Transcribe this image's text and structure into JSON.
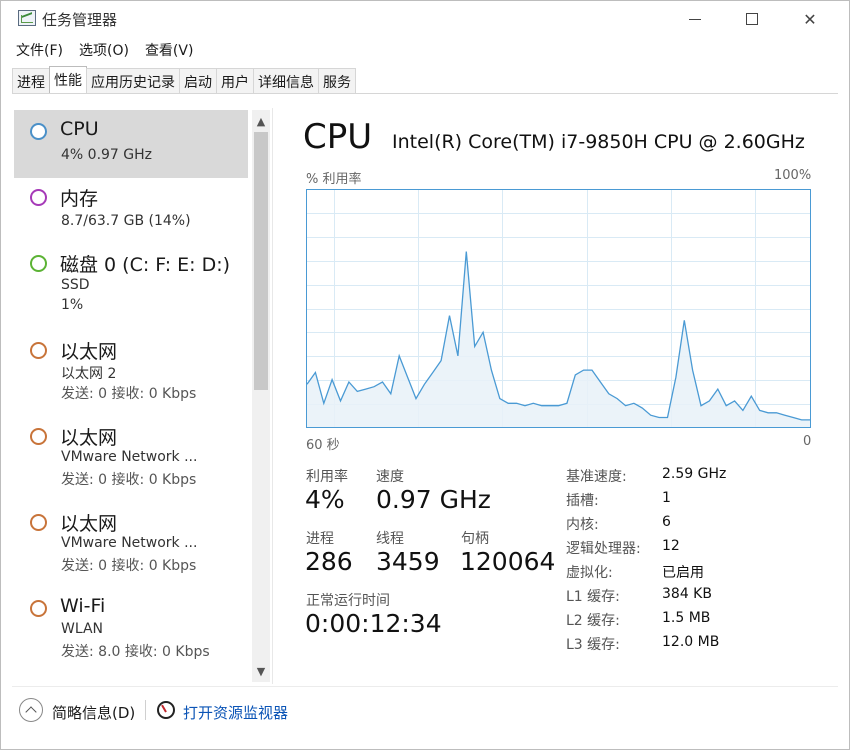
{
  "window": {
    "title": "任务管理器",
    "menu": [
      "文件(F)",
      "选项(O)",
      "查看(V)"
    ],
    "tabs": [
      "进程",
      "性能",
      "应用历史记录",
      "启动",
      "用户",
      "详细信息",
      "服务"
    ],
    "active_tab": "性能"
  },
  "resources": [
    {
      "name": "CPU",
      "sub": "4%  0.97 GHz",
      "sub2": "",
      "color": "#4a90c8",
      "selected": true
    },
    {
      "name": "内存",
      "sub": "8.7/63.7 GB (14%)",
      "sub2": "",
      "color": "#a63ab8",
      "selected": false
    },
    {
      "name": "磁盘 0 (C: F: E: D:)",
      "sub": "SSD",
      "sub2": "1%",
      "color": "#5cb335",
      "selected": false
    },
    {
      "name": "以太网",
      "sub": "以太网 2",
      "sub2": "发送: 0 接收: 0 Kbps",
      "color": "#c8743a",
      "selected": false
    },
    {
      "name": "以太网",
      "sub": "VMware Network ...",
      "sub2": "发送: 0 接收: 0 Kbps",
      "color": "#c8743a",
      "selected": false
    },
    {
      "name": "以太网",
      "sub": "VMware Network ...",
      "sub2": "发送: 0 接收: 0 Kbps",
      "color": "#c8743a",
      "selected": false
    },
    {
      "name": "Wi-Fi",
      "sub": "WLAN",
      "sub2": "发送: 8.0 接收: 0 Kbps",
      "color": "#c8743a",
      "selected": false
    }
  ],
  "cpu": {
    "title": "CPU",
    "model": "Intel(R) Core(TM) i7-9850H CPU @ 2.60GHz",
    "axis_top_left": "% 利用率",
    "axis_top_right": "100%",
    "axis_bottom_left": "60 秒",
    "axis_bottom_right": "0",
    "stats": {
      "utilization_label": "利用率",
      "utilization": "4%",
      "speed_label": "速度",
      "speed": "0.97 GHz",
      "processes_label": "进程",
      "processes": "286",
      "threads_label": "线程",
      "threads": "3459",
      "handles_label": "句柄",
      "handles": "120064",
      "uptime_label": "正常运行时间",
      "uptime": "0:00:12:34"
    },
    "info": [
      {
        "key": "基准速度:",
        "val": "2.59 GHz"
      },
      {
        "key": "插槽:",
        "val": "1"
      },
      {
        "key": "内核:",
        "val": "6"
      },
      {
        "key": "逻辑处理器:",
        "val": "12"
      },
      {
        "key": "虚拟化:",
        "val": "已启用"
      },
      {
        "key": "L1 缓存:",
        "val": "384 KB"
      },
      {
        "key": "L2 缓存:",
        "val": "1.5 MB"
      },
      {
        "key": "L3 缓存:",
        "val": "12.0 MB"
      }
    ]
  },
  "chart_data": {
    "type": "area",
    "ylim": [
      0,
      100
    ],
    "xlim": [
      60,
      0
    ],
    "xlabel": "60 秒",
    "ylabel": "% 利用率",
    "grid": true,
    "color": "#4a9ad4",
    "fill": "#e8f1f8",
    "series": [
      {
        "values": [
          18,
          23,
          10,
          20,
          11,
          19,
          15,
          16,
          17,
          19,
          14,
          30,
          21,
          12,
          18,
          23,
          28,
          47,
          30,
          74,
          34,
          40,
          24,
          12,
          10,
          10,
          9,
          10,
          9,
          9,
          9,
          10,
          22,
          24,
          24,
          19,
          14,
          12,
          9,
          10,
          8,
          5,
          4,
          4,
          21,
          45,
          24,
          9,
          11,
          16,
          9,
          11,
          7,
          13,
          7,
          6,
          6,
          5,
          4,
          3,
          3
        ]
      }
    ]
  },
  "footer": {
    "fewer_details": "简略信息(D)",
    "open_monitor": "打开资源监视器"
  }
}
